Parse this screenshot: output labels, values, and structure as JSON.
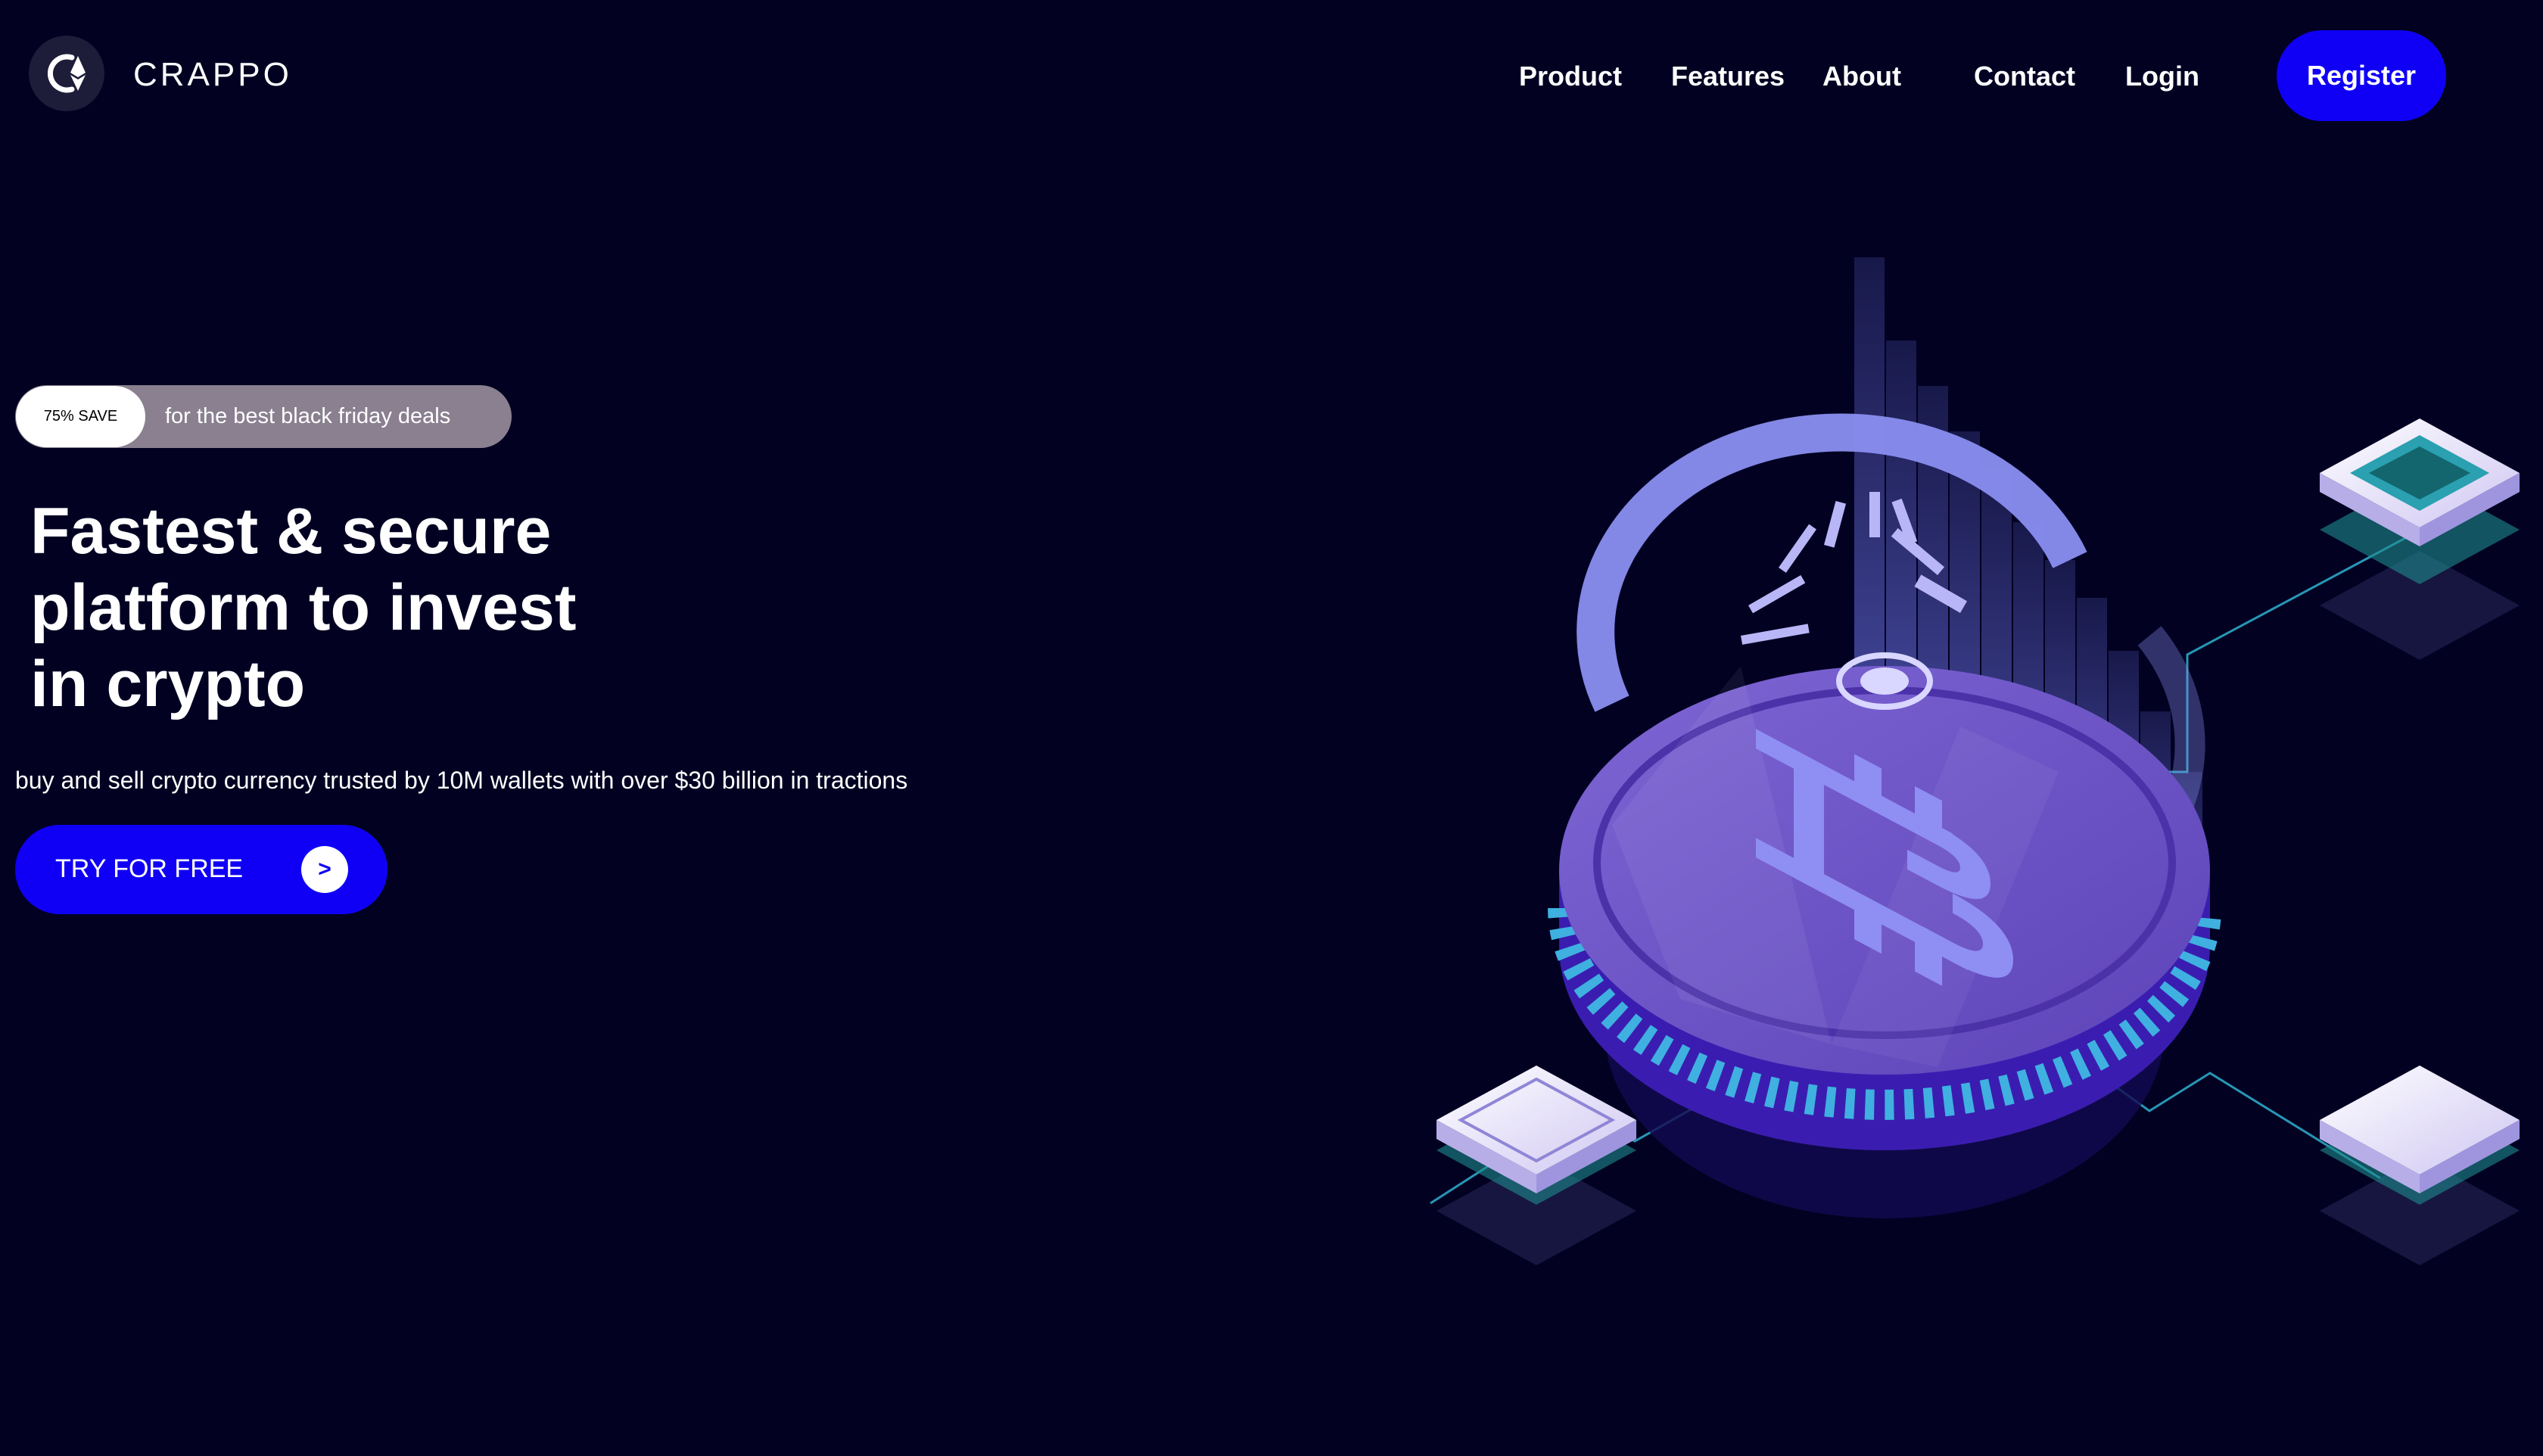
{
  "brand": {
    "name": "CRAPPO",
    "logo_icon": "crappo-logo-icon"
  },
  "nav": {
    "items": [
      {
        "label": "Product"
      },
      {
        "label": "Features"
      },
      {
        "label": "About"
      },
      {
        "label": "Contact"
      },
      {
        "label": "Login"
      }
    ],
    "register_label": "Register"
  },
  "hero": {
    "promo_badge": "75% SAVE",
    "promo_text": "for the best black friday deals",
    "headline_lines": [
      "Fastest & secure",
      "platform to invest",
      "in crypto"
    ],
    "subheadline": "buy and sell crypto currency trusted by 10M wallets with over $30 billion in tractions",
    "cta_label": "TRY FOR FREE",
    "cta_arrow": ">"
  },
  "colors": {
    "background": "#020122",
    "accent": "#0f00f5",
    "promo_pill": "#8a8090",
    "coin": "#6c54c4"
  },
  "illustration": {
    "icon": "bitcoin-coin-illustration"
  }
}
